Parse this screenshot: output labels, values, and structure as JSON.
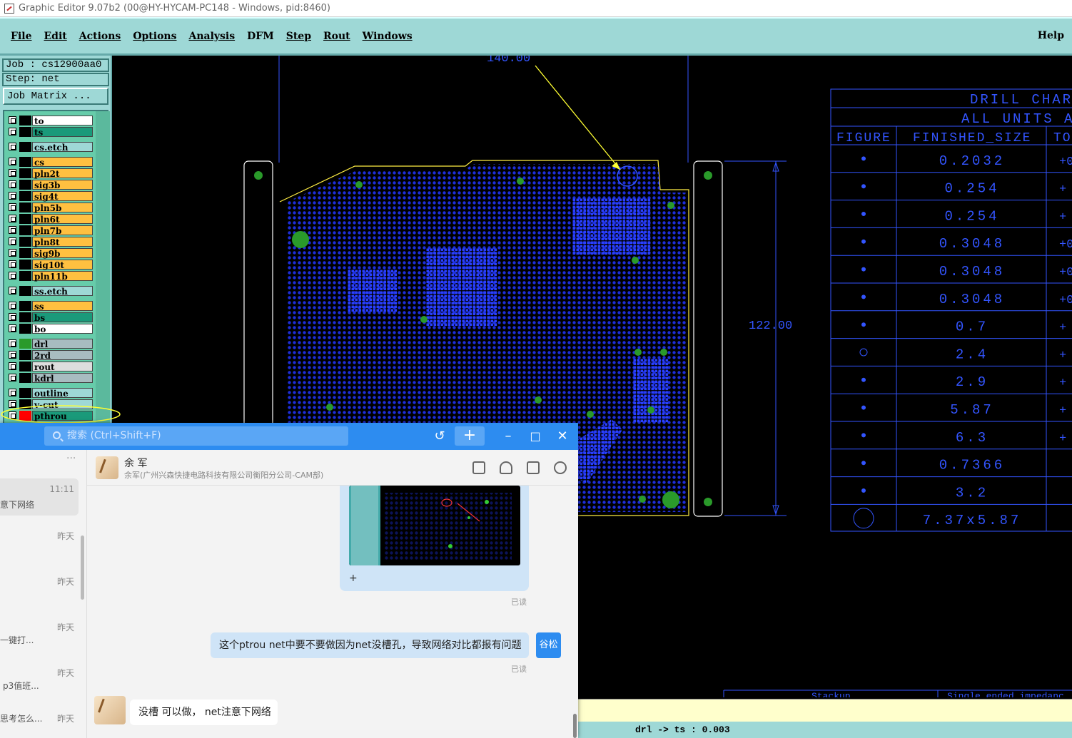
{
  "window": {
    "title": "Graphic Editor 9.07b2 (00@HY-HYCAM-PC148 - Windows, pid:8460)"
  },
  "menu": {
    "items": [
      "File",
      "Edit",
      "Actions",
      "Options",
      "Analysis",
      "DFM",
      "Step",
      "Rout",
      "Windows"
    ],
    "help": "Help"
  },
  "job": {
    "job_label": "Job : cs12900aa0",
    "step_label": "Step: net",
    "matrix_button": "Job Matrix ..."
  },
  "layers": [
    {
      "name": "to",
      "color": "#ffffff"
    },
    {
      "name": "ts",
      "color": "#1a9a7a"
    },
    {
      "name": "cs.etch",
      "color": "#9ed8d6"
    },
    {
      "name": "cs",
      "color": "#ffc040"
    },
    {
      "name": "pln2t",
      "color": "#ffc040"
    },
    {
      "name": "sig3b",
      "color": "#ffc040"
    },
    {
      "name": "sig4t",
      "color": "#ffc040"
    },
    {
      "name": "pln5b",
      "color": "#ffc040"
    },
    {
      "name": "pln6t",
      "color": "#ffc040"
    },
    {
      "name": "pln7b",
      "color": "#ffc040"
    },
    {
      "name": "pln8t",
      "color": "#ffc040"
    },
    {
      "name": "sig9b",
      "color": "#ffc040"
    },
    {
      "name": "sig10t",
      "color": "#ffc040"
    },
    {
      "name": "pln11b",
      "color": "#ffc040"
    },
    {
      "name": "ss.etch",
      "color": "#9ed8d6"
    },
    {
      "name": "ss",
      "color": "#ffc040"
    },
    {
      "name": "bs",
      "color": "#1a9a7a"
    },
    {
      "name": "bo",
      "color": "#ffffff"
    },
    {
      "name": "drl",
      "color": "#a8bcc0"
    },
    {
      "name": "2rd",
      "color": "#a8bcc0"
    },
    {
      "name": "rout",
      "color": "#dddddd"
    },
    {
      "name": "kdrl",
      "color": "#a8bcc0"
    },
    {
      "name": "outline",
      "color": "#9ed8d6"
    },
    {
      "name": "v-cut",
      "color": "#9ed8d6"
    },
    {
      "name": "pthrou",
      "color": "#1a9a7a"
    }
  ],
  "canvas": {
    "dim_top": "140.00",
    "dim_right": "122.00",
    "drill_chart": {
      "title": "DRILL CHART",
      "subtitle": "ALL UNITS AR",
      "headers": [
        "FIGURE",
        "FINISHED_SIZE",
        "TO"
      ],
      "sizes": [
        "0.2032",
        "0.254",
        "0.254",
        "0.3048",
        "0.3048",
        "0.3048",
        "0.7",
        "2.4",
        "2.9",
        "5.87",
        "6.3",
        "0.7366",
        "3.2",
        "7.37x5.87"
      ],
      "tol": [
        "+0",
        "+",
        "+",
        "+0",
        "+0",
        "+0",
        "+",
        "+",
        "+",
        "+",
        "+",
        "",
        "",
        ""
      ]
    },
    "stackup_label": "Stackup",
    "impedance_label": "Single ended impedanc"
  },
  "coord": {
    "text": "drl -> ts : 0.003"
  },
  "chat": {
    "search_placeholder": "搜索 (Ctrl+Shift+F)",
    "more": "···",
    "contact_name": "余 军",
    "contact_org": "余军(广州兴森快捷电路科技有限公司衡阳分公司-CAM部)",
    "sessions": [
      {
        "time": "11:11",
        "preview": "意下网络"
      },
      {
        "time": "昨天",
        "preview": ""
      },
      {
        "time": "昨天",
        "preview": ""
      },
      {
        "time": "昨天",
        "preview": "一键打..."
      },
      {
        "time": "昨天",
        "preview": "p3值班..."
      },
      {
        "time": "昨天",
        "preview": "思考怎么..."
      }
    ],
    "img_plus": "+",
    "read1": "已读",
    "out_message": "这个ptrou net中要不要做因为net没槽孔，导致网络对比都报有问题",
    "me_label": "谷松",
    "read2": "已读",
    "in_message": "没槽 可以做， net注意下网络"
  }
}
